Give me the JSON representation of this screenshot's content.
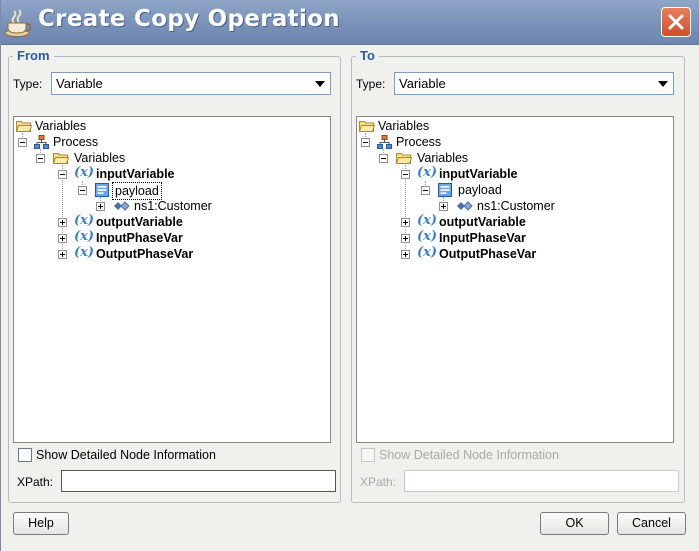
{
  "window": {
    "title": "Create Copy Operation"
  },
  "from": {
    "legend": "From",
    "type_label": "Type:",
    "type_value": "Variable",
    "tree": {
      "root": "Variables",
      "process": "Process",
      "variables": "Variables",
      "input_variable": "inputVariable",
      "payload": "payload",
      "customer": "ns1:Customer",
      "output_variable": "outputVariable",
      "input_phase_var": "InputPhaseVar",
      "output_phase_var": "OutputPhaseVar",
      "var_glyph": "(x)"
    },
    "show_details_label": "Show Detailed Node Information",
    "xpath_label": "XPath:",
    "xpath_value": ""
  },
  "to": {
    "legend": "To",
    "type_label": "Type:",
    "type_value": "Variable",
    "tree": {
      "root": "Variables",
      "process": "Process",
      "variables": "Variables",
      "input_variable": "inputVariable",
      "payload": "payload",
      "customer": "ns1:Customer",
      "output_variable": "outputVariable",
      "input_phase_var": "InputPhaseVar",
      "output_phase_var": "OutputPhaseVar",
      "var_glyph": "(x)"
    },
    "show_details_label": "Show Detailed Node Information",
    "xpath_label": "XPath:",
    "xpath_value": ""
  },
  "buttons": {
    "help": "Help",
    "ok": "OK",
    "cancel": "Cancel"
  },
  "colors": {
    "titlebar": "#7b93ba",
    "legend": "#2a5aa8",
    "variable_icon": "#3a7fcf",
    "close": "#cf4d2a"
  }
}
